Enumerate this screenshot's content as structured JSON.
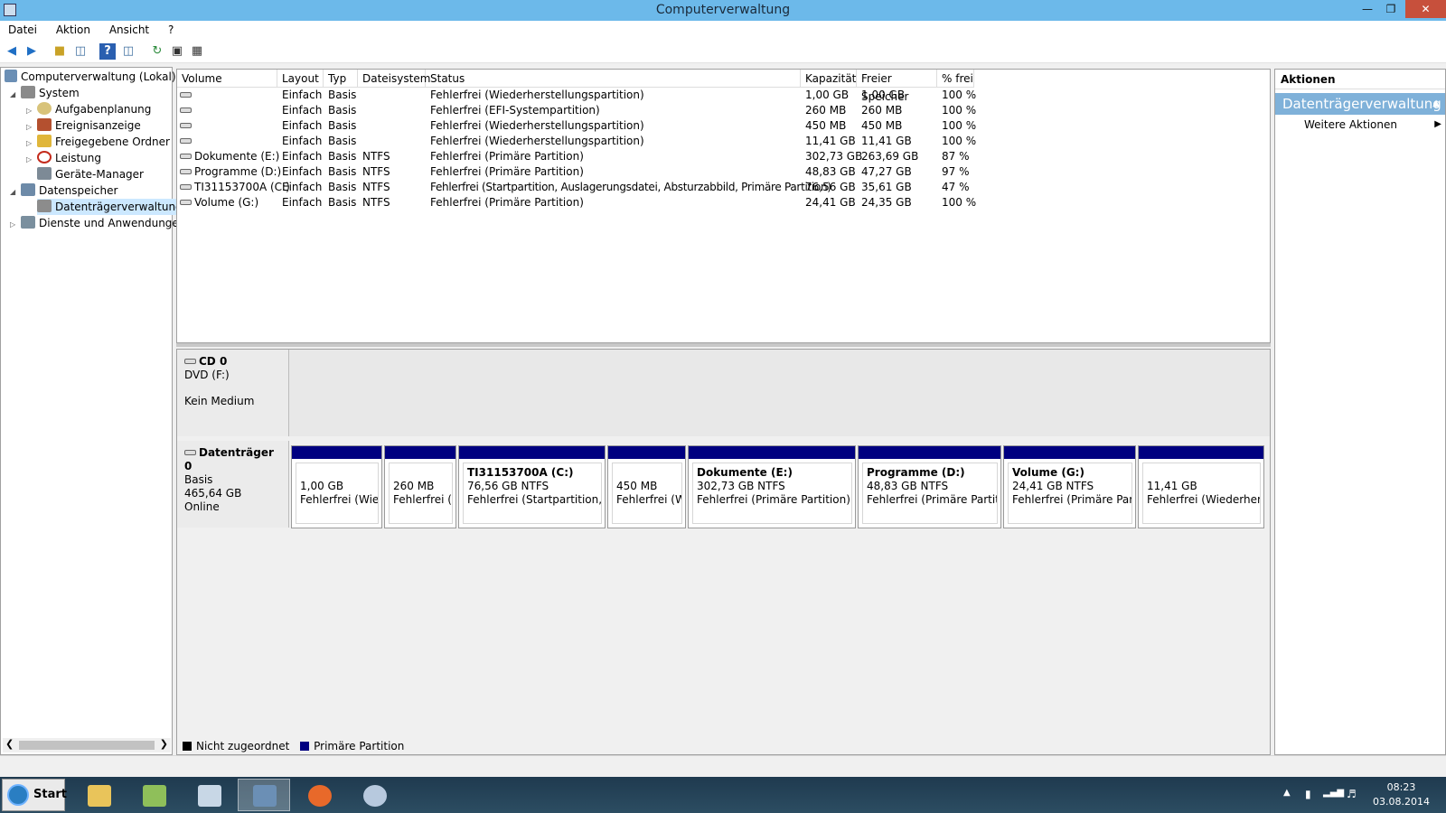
{
  "window": {
    "title": "Computerverwaltung"
  },
  "menu": [
    "Datei",
    "Aktion",
    "Ansicht",
    "?"
  ],
  "tree": {
    "root": "Computerverwaltung (Lokal)",
    "items": [
      {
        "label": "System"
      },
      {
        "label": "Aufgabenplanung"
      },
      {
        "label": "Ereignisanzeige"
      },
      {
        "label": "Freigegebene Ordner"
      },
      {
        "label": "Leistung"
      },
      {
        "label": "Geräte-Manager"
      },
      {
        "label": "Datenspeicher"
      },
      {
        "label": "Datenträgerverwaltung"
      },
      {
        "label": "Dienste und Anwendungen"
      }
    ]
  },
  "volumes": {
    "headers": [
      "Volume",
      "Layout",
      "Typ",
      "Dateisystem",
      "Status",
      "Kapazität",
      "Freier Speicher",
      "% frei"
    ],
    "rows": [
      {
        "volume": "",
        "layout": "Einfach",
        "typ": "Basis",
        "fs": "",
        "status": "Fehlerfrei (Wiederherstellungspartition)",
        "cap": "1,00 GB",
        "free": "1,00 GB",
        "pct": "100 %"
      },
      {
        "volume": "",
        "layout": "Einfach",
        "typ": "Basis",
        "fs": "",
        "status": "Fehlerfrei (EFI-Systempartition)",
        "cap": "260 MB",
        "free": "260 MB",
        "pct": "100 %"
      },
      {
        "volume": "",
        "layout": "Einfach",
        "typ": "Basis",
        "fs": "",
        "status": "Fehlerfrei (Wiederherstellungspartition)",
        "cap": "450 MB",
        "free": "450 MB",
        "pct": "100 %"
      },
      {
        "volume": "",
        "layout": "Einfach",
        "typ": "Basis",
        "fs": "",
        "status": "Fehlerfrei (Wiederherstellungspartition)",
        "cap": "11,41 GB",
        "free": "11,41 GB",
        "pct": "100 %"
      },
      {
        "volume": "Dokumente (E:)",
        "layout": "Einfach",
        "typ": "Basis",
        "fs": "NTFS",
        "status": "Fehlerfrei (Primäre Partition)",
        "cap": "302,73 GB",
        "free": "263,69 GB",
        "pct": "87 %"
      },
      {
        "volume": "Programme (D:)",
        "layout": "Einfach",
        "typ": "Basis",
        "fs": "NTFS",
        "status": "Fehlerfrei (Primäre Partition)",
        "cap": "48,83 GB",
        "free": "47,27 GB",
        "pct": "97 %"
      },
      {
        "volume": "TI31153700A (C:)",
        "layout": "Einfach",
        "typ": "Basis",
        "fs": "NTFS",
        "status": "Fehlerfrei (Startpartition, Auslagerungsdatei, Absturzabbild, Primäre Partition)",
        "cap": "76,56 GB",
        "free": "35,61 GB",
        "pct": "47 %"
      },
      {
        "volume": "Volume (G:)",
        "layout": "Einfach",
        "typ": "Basis",
        "fs": "NTFS",
        "status": "Fehlerfrei (Primäre Partition)",
        "cap": "24,41 GB",
        "free": "24,35 GB",
        "pct": "100 %"
      }
    ]
  },
  "cd": {
    "name": "CD 0",
    "drive": "DVD (F:)",
    "media": "Kein Medium"
  },
  "disk0": {
    "name": "Datenträger 0",
    "type": "Basis",
    "size": "465,64 GB",
    "state": "Online",
    "partitions": [
      {
        "title": "",
        "size": "1,00 GB",
        "status": "Fehlerfrei (Wiederherstellungspartition)"
      },
      {
        "title": "",
        "size": "260 MB",
        "status": "Fehlerfrei (EFI-Systempartition)"
      },
      {
        "title": "TI31153700A  (C:)",
        "size": "76,56 GB NTFS",
        "status": "Fehlerfrei (Startpartition, Auslagerungsdatei, Absturzabbild, Primäre Partition)"
      },
      {
        "title": "",
        "size": "450 MB",
        "status": "Fehlerfrei (Wiederherstellungspartition)"
      },
      {
        "title": "Dokumente  (E:)",
        "size": "302,73 GB NTFS",
        "status": "Fehlerfrei (Primäre Partition)"
      },
      {
        "title": "Programme  (D:)",
        "size": "48,83 GB NTFS",
        "status": "Fehlerfrei (Primäre Partition)"
      },
      {
        "title": "Volume  (G:)",
        "size": "24,41 GB NTFS",
        "status": "Fehlerfrei (Primäre Partition)"
      },
      {
        "title": "",
        "size": "11,41 GB",
        "status": "Fehlerfrei (Wiederherstellungspartition)"
      }
    ]
  },
  "legend": {
    "unallocated": "Nicht zugeordnet",
    "primary": "Primäre Partition",
    "unallocated_color": "#000000",
    "primary_color": "#000080"
  },
  "actions": {
    "header": "Aktionen",
    "section": "Datenträgerverwaltung",
    "more": "Weitere Aktionen"
  },
  "taskbar": {
    "start": "Start",
    "time": "08:23",
    "date": "03.08.2014"
  }
}
